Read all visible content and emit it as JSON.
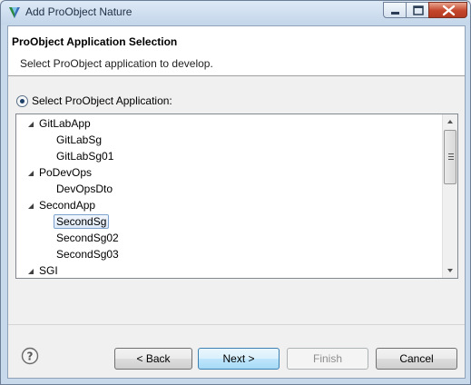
{
  "window": {
    "title": "Add ProObject Nature",
    "minimize_icon": "minimize-icon",
    "maximize_icon": "maximize-icon",
    "close_icon": "close-icon"
  },
  "header": {
    "title": "ProObject Application Selection",
    "description": "Select ProObject application to develop."
  },
  "selection": {
    "radio_label": "Select ProObject Application:",
    "radio_checked": true
  },
  "tree": {
    "items": [
      {
        "label": "GitLabApp",
        "level": 0,
        "expanded": true
      },
      {
        "label": "GitLabSg",
        "level": 1
      },
      {
        "label": "GitLabSg01",
        "level": 1
      },
      {
        "label": "PoDevOps",
        "level": 0,
        "expanded": true
      },
      {
        "label": "DevOpsDto",
        "level": 1
      },
      {
        "label": "SecondApp",
        "level": 0,
        "expanded": true
      },
      {
        "label": "SecondSg",
        "level": 1,
        "selected": true
      },
      {
        "label": "SecondSg02",
        "level": 1
      },
      {
        "label": "SecondSg03",
        "level": 1
      },
      {
        "label": "SGI",
        "level": 0,
        "expanded": true
      }
    ]
  },
  "buttons": {
    "back": "< Back",
    "next": "Next >",
    "finish": "Finish",
    "cancel": "Cancel"
  },
  "colors": {
    "selection_border": "#7da2ce",
    "default_button_border": "#3c7fb1",
    "close_button": "#c4452b"
  }
}
